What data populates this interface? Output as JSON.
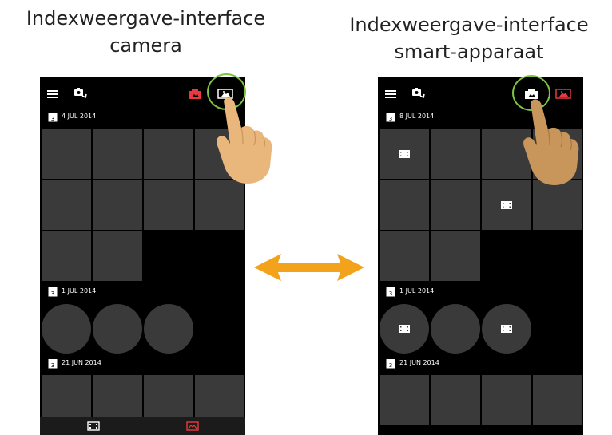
{
  "left_panel": {
    "title_line1": "Indexweergave-interface",
    "title_line2": "camera",
    "sections": [
      {
        "date": "4 JUL 2014"
      },
      {
        "date": "1 JUL 2014"
      },
      {
        "date": "21 JUN 2014"
      }
    ]
  },
  "right_panel": {
    "title_line1": "Indexweergave-interface",
    "title_line2": "smart-apparaat",
    "sections": [
      {
        "date": "8 JUL 2014"
      },
      {
        "date": "1 JUL 2014"
      },
      {
        "date": "21 JUN 2014"
      }
    ]
  },
  "colors": {
    "highlight_ring": "#7dc242",
    "active_icon": "#e8393f",
    "arrow": "#f2a21b",
    "thumbnail": "#3a3a3a",
    "hand_light": "#e9b77c",
    "hand_dark": "#c8955a"
  },
  "icons": [
    "menu-icon",
    "camera-switch-icon",
    "camera-gallery-icon",
    "device-gallery-icon",
    "calendar-icon",
    "video-icon",
    "double-arrow-icon",
    "pointing-hand-icon"
  ]
}
